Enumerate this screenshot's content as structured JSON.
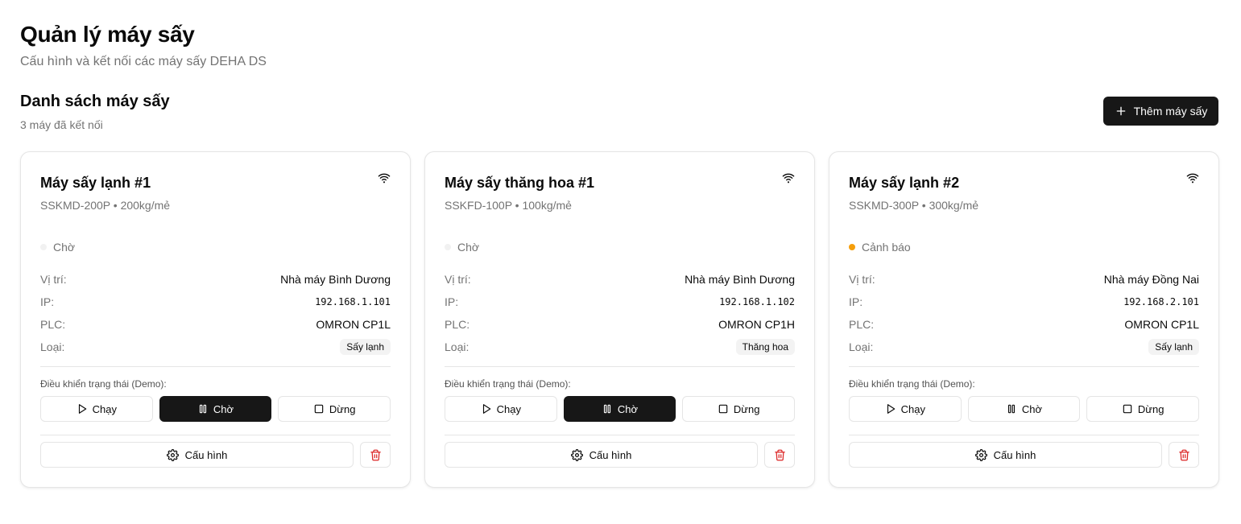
{
  "header": {
    "title": "Quản lý máy sấy",
    "subtitle": "Cấu hình và kết nối các máy sấy DEHA DS"
  },
  "section": {
    "title": "Danh sách máy sấy",
    "count_text": "3 máy đã kết nối",
    "add_button_label": "Thêm máy sấy"
  },
  "labels": {
    "location": "Vị trí:",
    "ip": "IP:",
    "plc": "PLC:",
    "type": "Loại:",
    "control": "Điều khiển trạng thái (Demo):",
    "run": "Chạy",
    "wait": "Chờ",
    "stop": "Dừng",
    "config": "Cấu hình"
  },
  "colors": {
    "primary": "#171717",
    "warning": "#f59e0b",
    "idle_dot": "#f1f1f1",
    "danger": "#dc2626"
  },
  "dryers": [
    {
      "name": "Máy sấy lạnh #1",
      "model": "SSKMD-200P • 200kg/mẻ",
      "status": "Chờ",
      "status_color": "#f1f1f1",
      "location": "Nhà máy Bình Dương",
      "ip": "192.168.1.101",
      "plc": "OMRON CP1L",
      "type": "Sấy lạnh",
      "active_control": "wait"
    },
    {
      "name": "Máy sấy thăng hoa #1",
      "model": "SSKFD-100P • 100kg/mẻ",
      "status": "Chờ",
      "status_color": "#f1f1f1",
      "location": "Nhà máy Bình Dương",
      "ip": "192.168.1.102",
      "plc": "OMRON CP1H",
      "type": "Thăng hoa",
      "active_control": "wait"
    },
    {
      "name": "Máy sấy lạnh #2",
      "model": "SSKMD-300P • 300kg/mẻ",
      "status": "Cảnh báo",
      "status_color": "#f59e0b",
      "location": "Nhà máy Đồng Nai",
      "ip": "192.168.2.101",
      "plc": "OMRON CP1L",
      "type": "Sấy lạnh",
      "active_control": "none"
    }
  ]
}
